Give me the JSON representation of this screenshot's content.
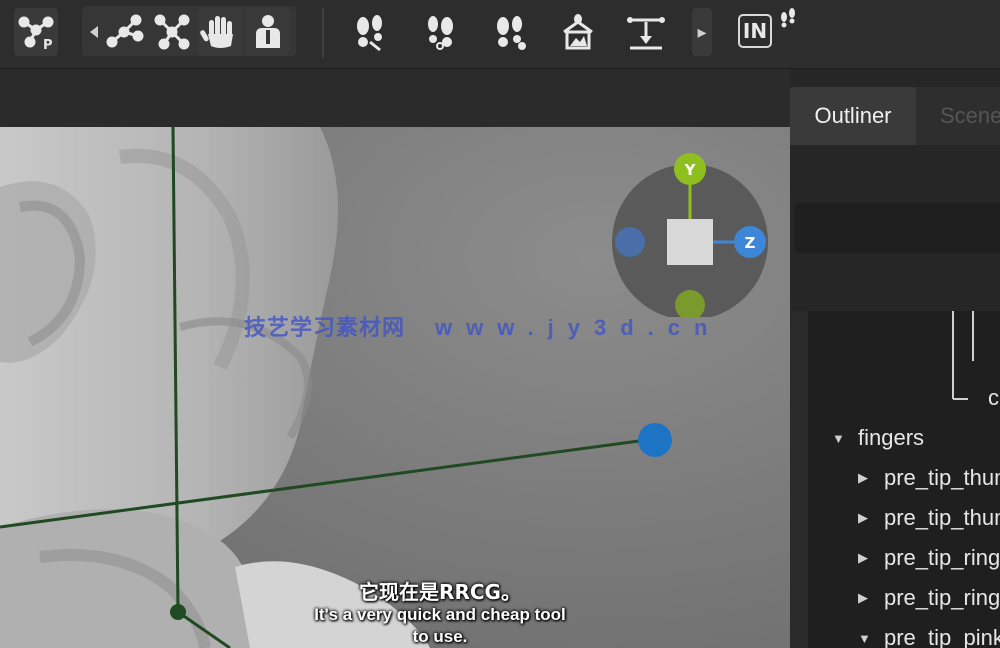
{
  "toolbar": {
    "in_label": "IN",
    "expand_arrow": "▸",
    "icons": [
      "skeleton-p-icon",
      "prev-arrow-icon",
      "bone-chain-icon",
      "bone-branch-icon",
      "hand-icon",
      "person-icon",
      "footprint-left-icon",
      "footprint-right-icon",
      "footprint-pair-icon",
      "house-icon",
      "ruler-icon",
      "expand-arrow-icon",
      "footprints-small-icon"
    ]
  },
  "viewport": {
    "gizmo": {
      "y_label": "Y",
      "z_label": "Z"
    },
    "watermark": {
      "cn": "技艺学习素材网",
      "url": "www.jy3d.cn"
    },
    "subtitle_cn": "它现在是RRCG。",
    "subtitle_en_line1": "It's a very quick and cheap tool",
    "subtitle_en_line2": "to use."
  },
  "outliner": {
    "tabs": [
      {
        "label": "Outliner",
        "active": true
      },
      {
        "label": "Scene",
        "active": false
      }
    ],
    "partial_item": "c",
    "items": [
      {
        "label": "fingers",
        "expanded": true
      },
      {
        "label": "pre_tip_thumb",
        "expanded": false
      },
      {
        "label": "pre_tip_thumb",
        "expanded": false
      },
      {
        "label": "pre_tip_ring",
        "expanded": false
      },
      {
        "label": "pre_tip_ring",
        "expanded": false
      },
      {
        "label": "pre_tip_pinky",
        "expanded": true
      }
    ]
  },
  "colors": {
    "y_axis": "#8fbf1e",
    "z_axis": "#3d86d8",
    "x_neg": "#4a6ea8",
    "bone_line": "#1f4a22",
    "joint_blue": "#1d74c4"
  }
}
